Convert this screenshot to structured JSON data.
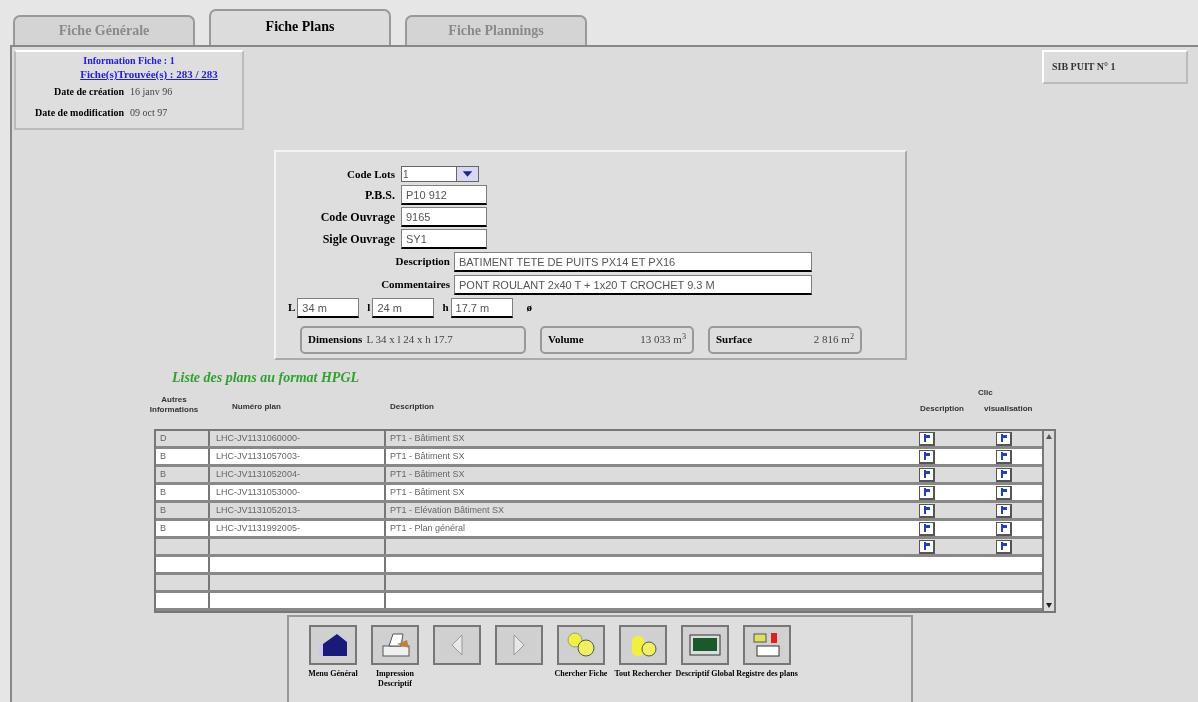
{
  "tabs": [
    {
      "label": "Fiche Générale",
      "selected": false
    },
    {
      "label": "Fiche Plans",
      "selected": true
    },
    {
      "label": "Fiche Plannings",
      "selected": false
    }
  ],
  "info": {
    "title": "Information Fiche : 1",
    "found": "Fiche(s)Trouvée(s) : 283 / 283",
    "dates": [
      {
        "label": "Date de création",
        "value": "16 janv 96"
      },
      {
        "label": "Date de modification",
        "value": "09 oct 97"
      }
    ]
  },
  "site": "SIB PUIT N° 1",
  "form": {
    "code_lots": {
      "label": "Code Lots",
      "value": "1"
    },
    "short_fields": [
      {
        "label": "P.B.S.",
        "value": "P10 912"
      },
      {
        "label": "Code Ouvrage",
        "value": "9165"
      },
      {
        "label": "Sigle Ouvrage",
        "value": "SY1"
      }
    ],
    "long_fields": [
      {
        "label": "Description",
        "value": "BATIMENT TETE DE PUITS PX14 ET PX16"
      },
      {
        "label": "Commentaires",
        "value": "PONT ROULANT 2x40 T + 1x20 T CROCHET 9.3 M"
      }
    ],
    "dims": [
      {
        "label": "L",
        "value": "34 m"
      },
      {
        "label": "l",
        "value": "24 m"
      },
      {
        "label": "h",
        "value": "17.7 m"
      }
    ],
    "diameter": "ø",
    "summary": [
      {
        "label": "Dimensions",
        "value": "L 34 x l 24 x h 17.7"
      },
      {
        "label": "Volume",
        "value": "13 033 m$^{3}$"
      },
      {
        "label": "Surface",
        "value": "2 816 m$^{2}$"
      }
    ]
  },
  "plans": {
    "title": "Liste des plans au format HPGL",
    "click_label": "Clic",
    "columns": [
      "Autres Informations",
      "Numéro plan",
      "Description",
      "Description",
      "visualisation"
    ],
    "rows": [
      {
        "kind": "plan",
        "info": "D",
        "number": "LHC-JV1131060000-",
        "description": "PT1 - Bâtiment SX"
      },
      {
        "kind": "plan",
        "info": "B",
        "number": "LHC-JV1131057003-",
        "description": "PT1 - Bâtiment SX"
      },
      {
        "kind": "plan",
        "info": "B",
        "number": "LHC-JV1131052004-",
        "description": "PT1 - Bâtiment SX"
      },
      {
        "kind": "plan",
        "info": "B",
        "number": "LHC-JV1131053000-",
        "description": "PT1 - Bâtiment SX"
      },
      {
        "kind": "plan",
        "info": "B",
        "number": "LHC-JV1131052013-",
        "description": "PT1 - Elévation Bâtiment SX"
      },
      {
        "kind": "plan",
        "info": "B",
        "number": "LHC-JV1131992005-",
        "description": "PT1 - Plan général"
      },
      {
        "kind": "new"
      },
      {
        "kind": "empty"
      },
      {
        "kind": "empty"
      },
      {
        "kind": "empty"
      }
    ]
  },
  "toolbar": [
    {
      "kind": "menu",
      "label": "Menu Général"
    },
    {
      "kind": "print",
      "label": "Impression Descriptif"
    },
    {
      "kind": "prev"
    },
    {
      "kind": "next"
    },
    {
      "kind": "find",
      "label": "Chercher Fiche"
    },
    {
      "kind": "findall",
      "label": "Tout Rechercher"
    },
    {
      "kind": "global",
      "label": "Descriptif Global"
    },
    {
      "kind": "register",
      "label": "Registre des plans"
    }
  ]
}
